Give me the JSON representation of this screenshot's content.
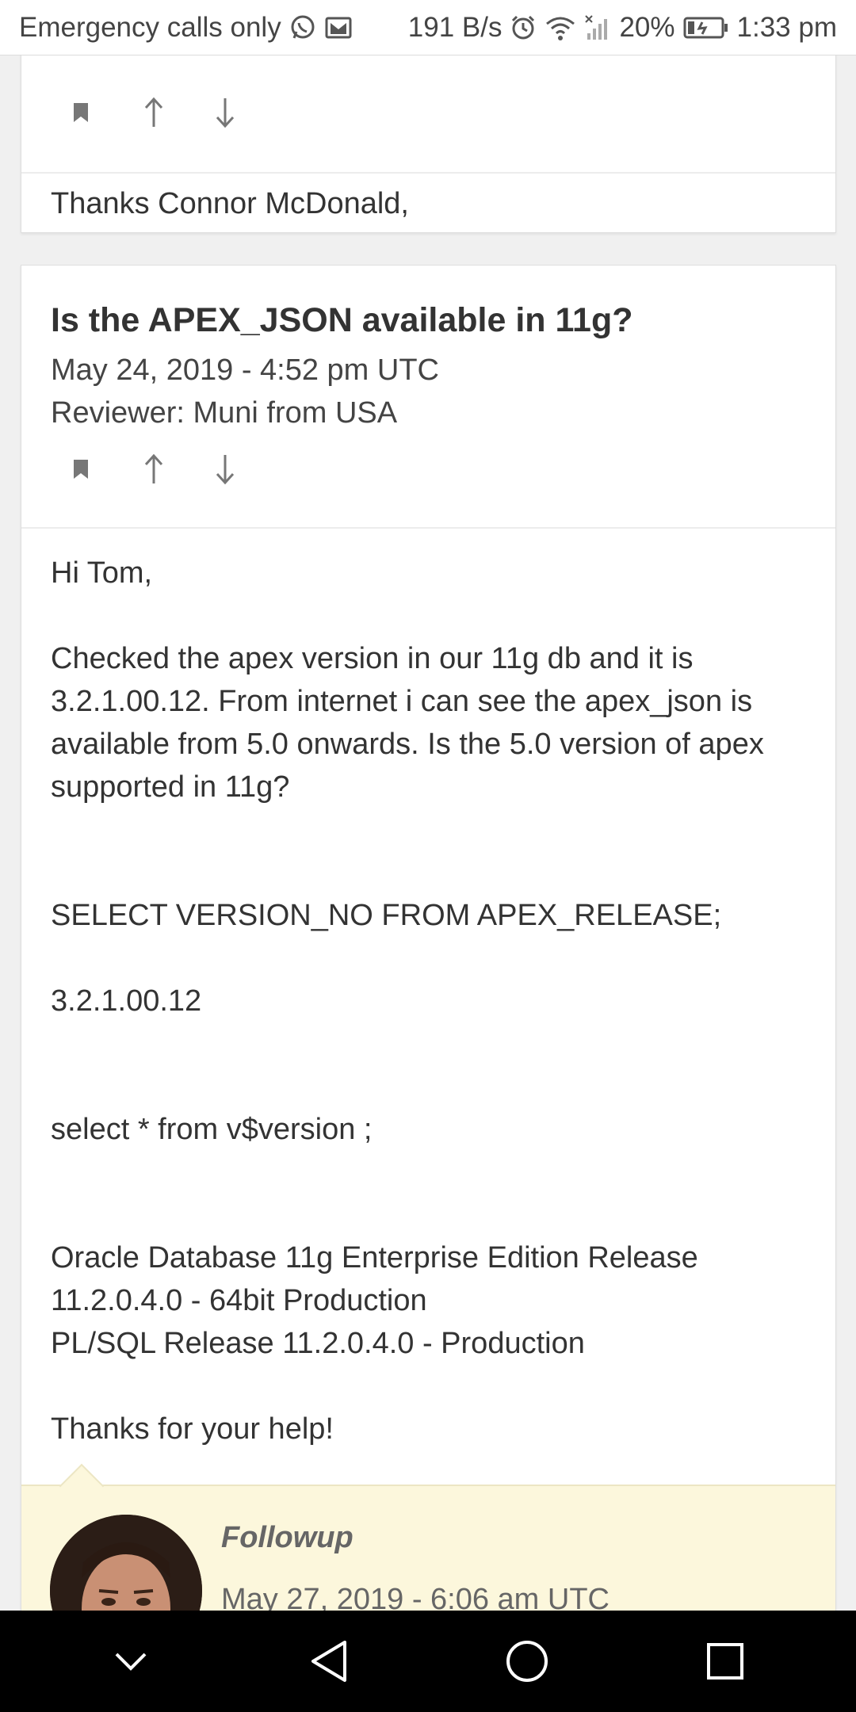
{
  "status_bar": {
    "carrier": "Emergency calls only",
    "net_speed": "191 B/s",
    "battery": "20%",
    "time": "1:33 pm",
    "icons": [
      "whatsapp-icon",
      "mail-icon",
      "alarm-icon",
      "wifi-icon",
      "signal-icon",
      "battery-charging-icon"
    ]
  },
  "review1": {
    "actions": [
      "bookmark-icon",
      "arrow-up-icon",
      "arrow-down-icon"
    ],
    "text": "Thanks Connor McDonald,"
  },
  "review2": {
    "title": "Is the APEX_JSON available in 11g?",
    "date": "May 24, 2019 - 4:52 pm UTC",
    "reviewer": "Reviewer: Muni from USA",
    "actions": [
      "bookmark-icon",
      "arrow-up-icon",
      "arrow-down-icon"
    ],
    "body": {
      "greeting": "Hi Tom,",
      "para1": "Checked the apex version in our 11g db and it is 3.2.1.00.12. From internet i can see the apex_json is available from 5.0 onwards. Is the 5.0 version of apex supported in 11g?",
      "query1": "SELECT VERSION_NO FROM APEX_RELEASE;",
      "result1": "3.2.1.00.12",
      "query2": "select * from v$version ;",
      "result2_line1": "Oracle Database 11g Enterprise Edition Release 11.2.0.4.0 - 64bit Production",
      "result2_line2": "PL/SQL Release 11.2.0.4.0 - Production",
      "closing": "Thanks for your help!"
    },
    "followup": {
      "label": "Followup",
      "date": "May 27, 2019 - 6:06 am UTC"
    }
  },
  "nav_bar": {
    "buttons": [
      "collapse-icon",
      "back-icon",
      "home-icon",
      "recents-icon"
    ]
  },
  "colors": {
    "background": "#f0f0f0",
    "card": "#ffffff",
    "followup_bg": "#fcf7dc",
    "text": "#333333"
  }
}
